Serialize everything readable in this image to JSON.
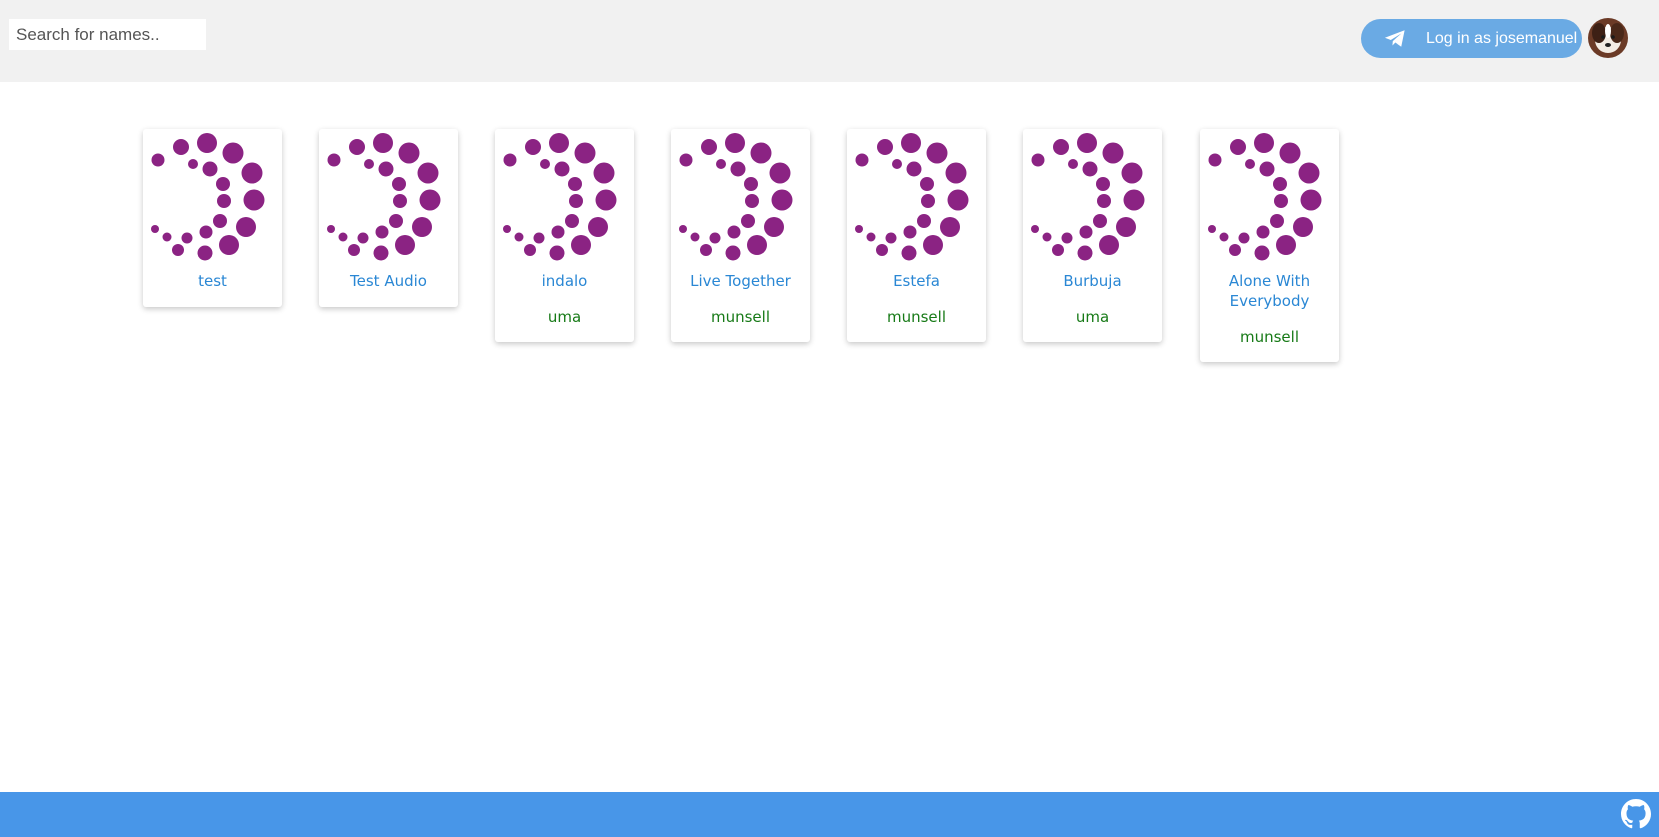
{
  "search": {
    "placeholder": "Search for names.."
  },
  "login": {
    "label": "Log in as josemanuel",
    "icon": "telegram-icon"
  },
  "avatar": {
    "icon": "dog-avatar"
  },
  "cards": [
    {
      "title": "test",
      "author": ""
    },
    {
      "title": "Test Audio",
      "author": ""
    },
    {
      "title": "indalo",
      "author": "uma"
    },
    {
      "title": "Live Together",
      "author": "munsell"
    },
    {
      "title": "Estefa",
      "author": "munsell"
    },
    {
      "title": "Burbuja",
      "author": "uma"
    },
    {
      "title": "Alone With Everybody",
      "author": "munsell"
    }
  ],
  "footer": {
    "icon": "github-icon"
  },
  "colors": {
    "header_bg": "#f1f1f1",
    "login_bg": "#6aaae4",
    "title": "#2a87d4",
    "author": "#177a17",
    "logo": "#8b2383",
    "footer_bg": "#4896e8"
  }
}
